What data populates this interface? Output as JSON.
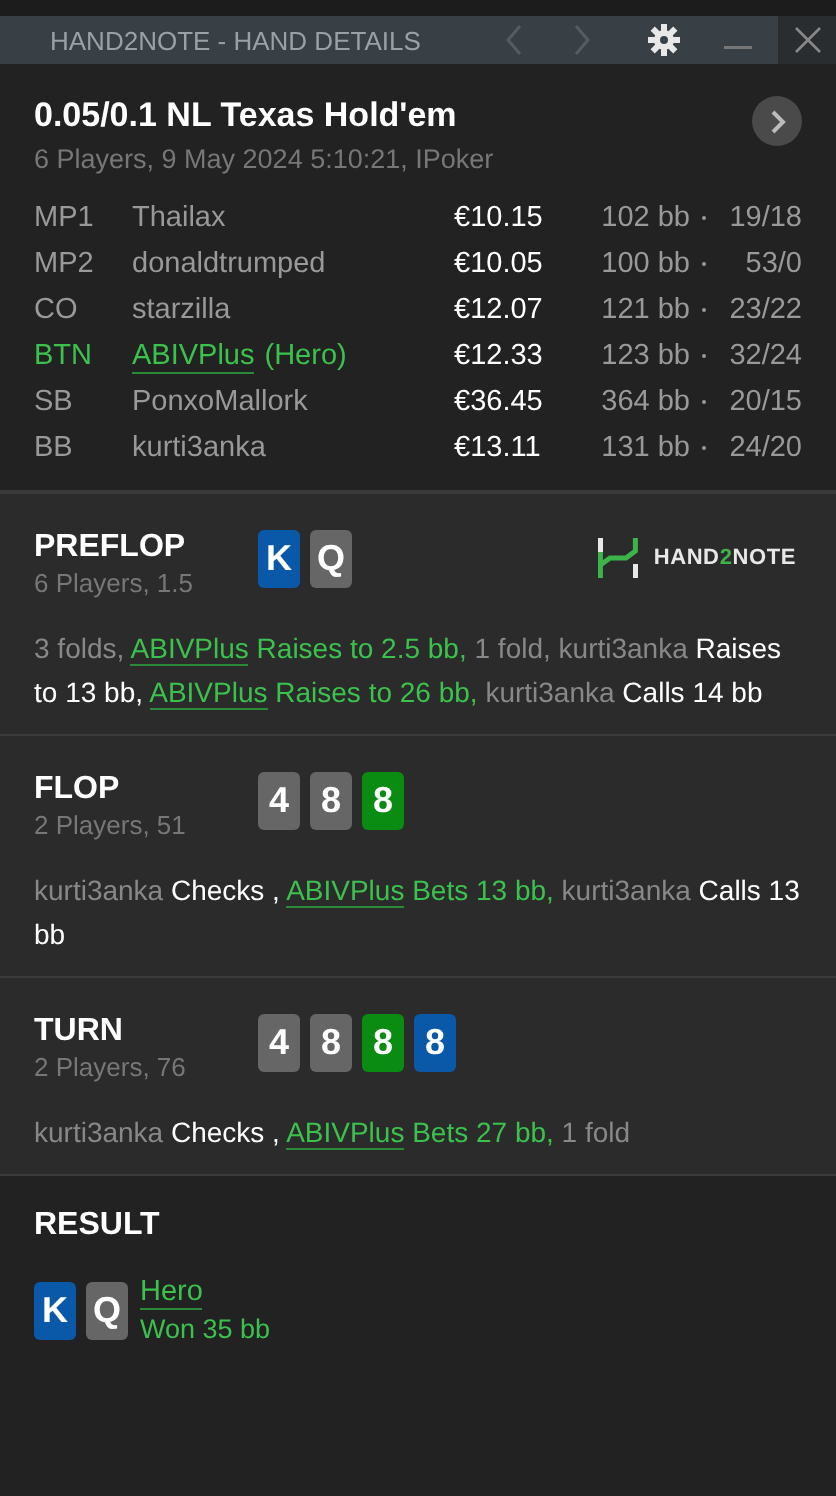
{
  "window": {
    "title": "HAND2NOTE - HAND DETAILS"
  },
  "header": {
    "title": "0.05/0.1 NL Texas Hold'em",
    "subtitle": "6 Players, 9 May 2024 5:10:21, IPoker"
  },
  "players": [
    {
      "position": "MP1",
      "name": "Thailax",
      "hero": false,
      "stack": "€10.15",
      "bb": "102 bb",
      "stats": "19/18"
    },
    {
      "position": "MP2",
      "name": "donaldtrumped",
      "hero": false,
      "stack": "€10.05",
      "bb": "100 bb",
      "stats": "53/0"
    },
    {
      "position": "CO",
      "name": "starzilla",
      "hero": false,
      "stack": "€12.07",
      "bb": "121 bb",
      "stats": "23/22"
    },
    {
      "position": "BTN",
      "name": "ABIVPlus",
      "suffix": "(Hero)",
      "hero": true,
      "stack": "€12.33",
      "bb": "123 bb",
      "stats": "32/24"
    },
    {
      "position": "SB",
      "name": "PonxoMallork",
      "hero": false,
      "stack": "€36.45",
      "bb": "364 bb",
      "stats": "20/15"
    },
    {
      "position": "BB",
      "name": "kurti3anka",
      "hero": false,
      "stack": "€13.11",
      "bb": "131 bb",
      "stats": "24/20"
    }
  ],
  "logo": {
    "parts": [
      "HAND",
      "2",
      "NOTE"
    ]
  },
  "streets": [
    {
      "name": "PREFLOP",
      "info": "6 Players, 1.5",
      "cards": [
        {
          "rank": "K",
          "color": "#0a59a8"
        },
        {
          "rank": "Q",
          "color": "#666666"
        }
      ],
      "actions": [
        {
          "kind": "muted",
          "text": "3 folds, "
        },
        {
          "kind": "hero-name",
          "text": "ABIVPlus"
        },
        {
          "kind": "hero-action",
          "text": " Raises to 2.5 bb,"
        },
        {
          "kind": "muted",
          "text": " 1 fold, kurti3anka"
        },
        {
          "kind": "action",
          "text": " Raises to 13 bb, "
        },
        {
          "kind": "hero-name",
          "text": "ABIVPlus"
        },
        {
          "kind": "hero-action",
          "text": " Raises to 26 bb,"
        },
        {
          "kind": "muted",
          "text": " kurti3anka"
        },
        {
          "kind": "action",
          "text": " Calls 14 bb"
        }
      ]
    },
    {
      "name": "FLOP",
      "info": "2 Players, 51",
      "cards": [
        {
          "rank": "4",
          "color": "#666666"
        },
        {
          "rank": "8",
          "color": "#666666"
        },
        {
          "rank": "8",
          "color": "#0a8c12"
        }
      ],
      "actions": [
        {
          "kind": "muted",
          "text": "kurti3anka"
        },
        {
          "kind": "action",
          "text": " Checks , "
        },
        {
          "kind": "hero-name",
          "text": "ABIVPlus"
        },
        {
          "kind": "hero-action",
          "text": " Bets 13 bb,"
        },
        {
          "kind": "muted",
          "text": " kurti3anka"
        },
        {
          "kind": "action",
          "text": " Calls 13 bb"
        }
      ]
    },
    {
      "name": "TURN",
      "info": "2 Players, 76",
      "cards": [
        {
          "rank": "4",
          "color": "#666666"
        },
        {
          "rank": "8",
          "color": "#666666"
        },
        {
          "rank": "8",
          "color": "#0a8c12"
        },
        {
          "rank": "8",
          "color": "#0a59a8"
        }
      ],
      "actions": [
        {
          "kind": "muted",
          "text": "kurti3anka"
        },
        {
          "kind": "action",
          "text": " Checks , "
        },
        {
          "kind": "hero-name",
          "text": "ABIVPlus"
        },
        {
          "kind": "hero-action",
          "text": " Bets 27 bb,"
        },
        {
          "kind": "muted",
          "text": " 1 fold"
        }
      ]
    }
  ],
  "result": {
    "title": "RESULT",
    "cards": [
      {
        "rank": "K",
        "color": "#0a59a8"
      },
      {
        "rank": "Q",
        "color": "#666666"
      }
    ],
    "winner": "Hero",
    "outcome": "Won 35 bb"
  }
}
